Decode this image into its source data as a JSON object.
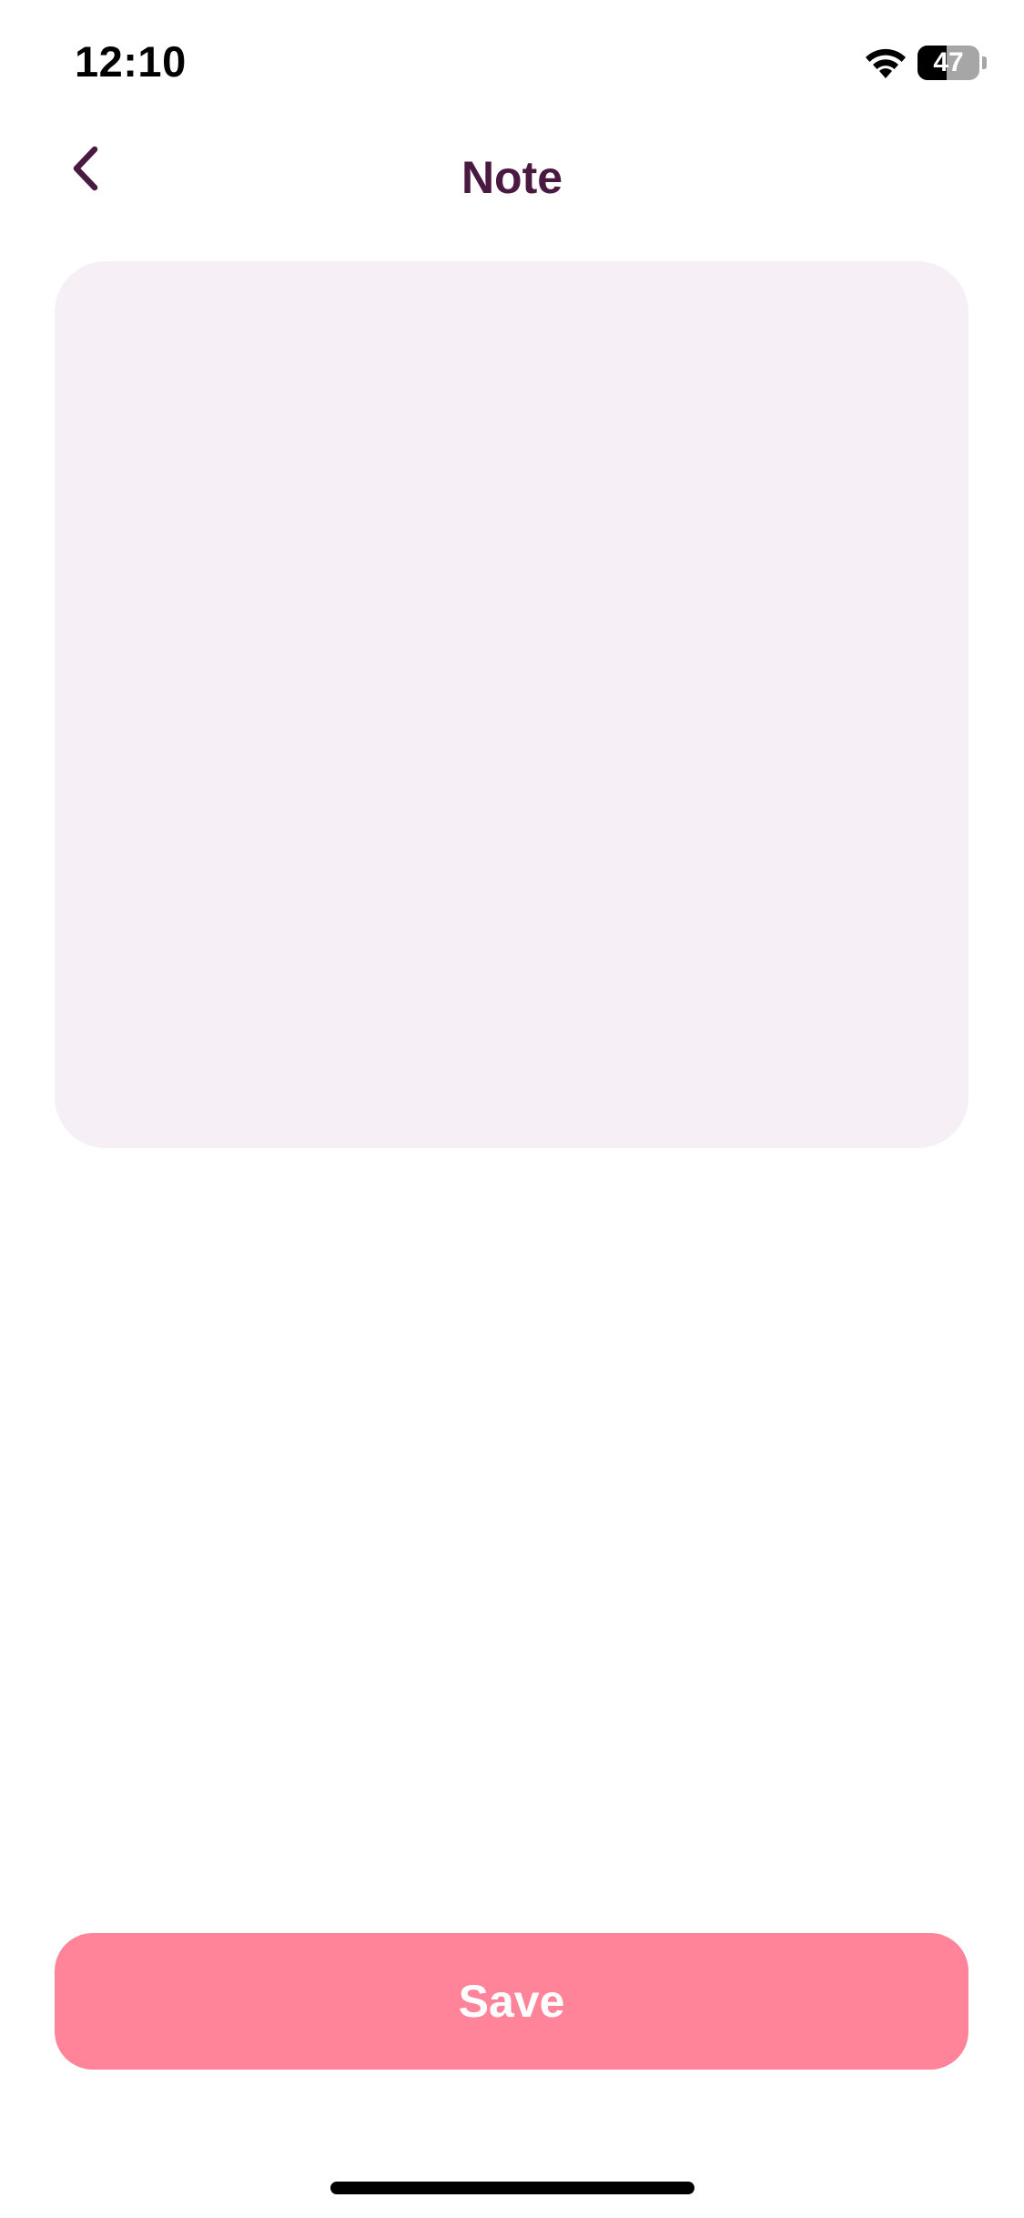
{
  "status_bar": {
    "time": "12:10",
    "battery_percent": "47",
    "battery_level": 0.47,
    "icons": [
      "wifi-icon",
      "battery-icon"
    ]
  },
  "header": {
    "back_icon": "chevron-left-icon",
    "title": "Note"
  },
  "note": {
    "value": "",
    "placeholder": ""
  },
  "footer": {
    "save_label": "Save"
  },
  "colors": {
    "title": "#4a1942",
    "note_background": "#f6eff5",
    "save_button": "#ff8499",
    "save_text": "#ffffff"
  }
}
